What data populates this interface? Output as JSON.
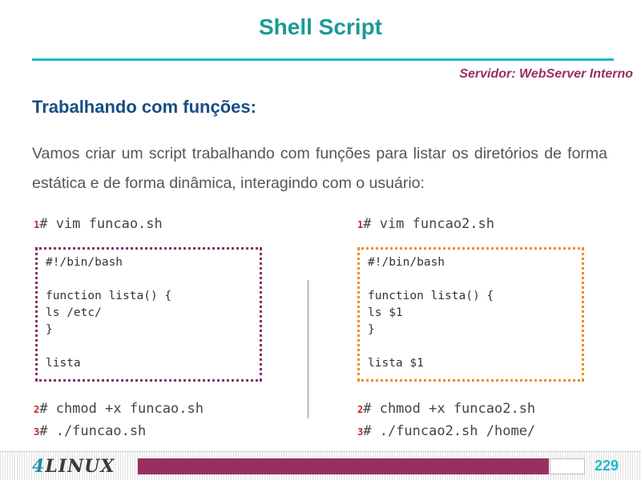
{
  "header": {
    "title": "Shell Script",
    "server": "Servidor: WebServer Interno"
  },
  "section": {
    "heading": "Trabalhando com funções:",
    "intro": "Vamos criar um script trabalhando com funções para listar os diretórios de forma estática e de forma dinâmica, interagindo com o usuário:"
  },
  "left": {
    "step1_num": "1",
    "step1_cmd": "# vim funcao.sh",
    "code": "#!/bin/bash\n\nfunction lista() {\nls /etc/\n}\n\nlista",
    "step2_num": "2",
    "step2_cmd": "# chmod +x funcao.sh",
    "step3_num": "3",
    "step3_cmd": "# ./funcao.sh"
  },
  "right": {
    "step1_num": "1",
    "step1_cmd": "# vim funcao2.sh",
    "code": "#!/bin/bash\n\nfunction lista() {\nls $1\n}\n\nlista $1",
    "step2_num": "2",
    "step2_cmd": "# chmod +x funcao2.sh",
    "step3_num": "3",
    "step3_cmd": "# ./funcao2.sh /home/"
  },
  "footer": {
    "logo_num": "4",
    "logo_text": "LINUX",
    "page_number": "229"
  },
  "colors": {
    "title": "#1a9a96",
    "accent_rule": "#22b8c6",
    "server": "#963063",
    "heading": "#174e86",
    "left_box_border": "#8a2d6b",
    "right_box_border": "#f08c1c",
    "footer_bar": "#963063"
  }
}
